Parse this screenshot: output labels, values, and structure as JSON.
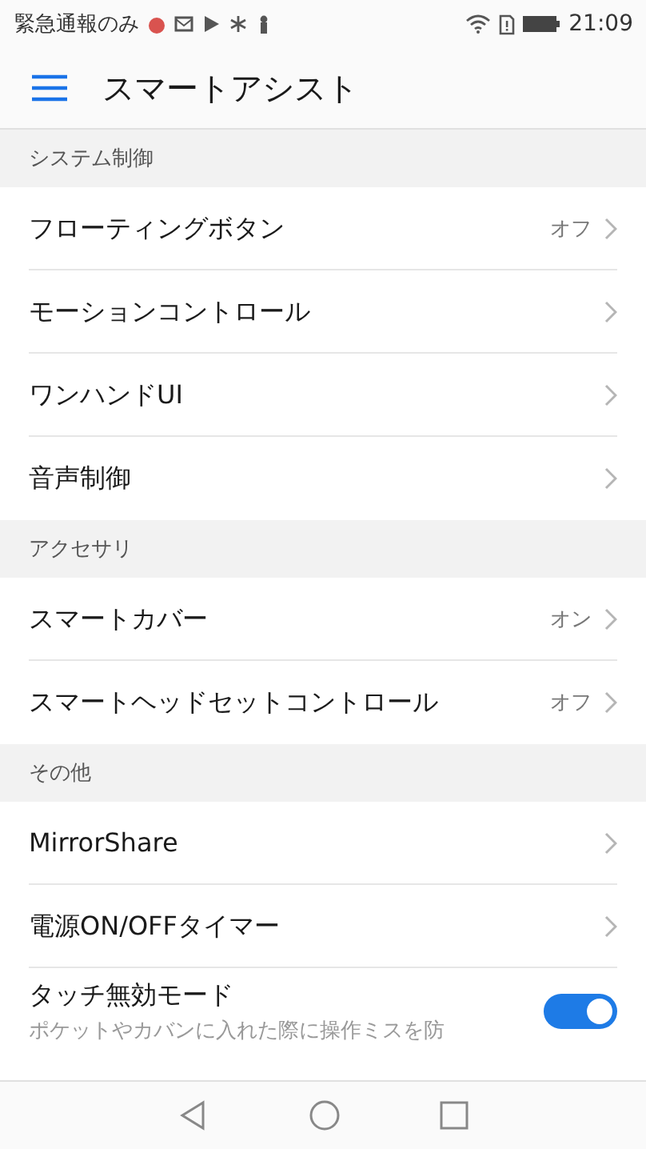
{
  "status_bar": {
    "carrier": "緊急通報のみ",
    "time": "21:09"
  },
  "app_bar": {
    "title": "スマートアシスト"
  },
  "sections": [
    {
      "title": "システム制御",
      "items": [
        {
          "kind": "link",
          "label": "フローティングボタン",
          "value": "オフ"
        },
        {
          "kind": "link",
          "label": "モーションコントロール"
        },
        {
          "kind": "link",
          "label": "ワンハンドUI"
        },
        {
          "kind": "link",
          "label": "音声制御"
        }
      ]
    },
    {
      "title": "アクセサリ",
      "items": [
        {
          "kind": "link",
          "label": "スマートカバー",
          "value": "オン"
        },
        {
          "kind": "link",
          "label": "スマートヘッドセットコントロール",
          "value": "オフ"
        }
      ]
    },
    {
      "title": "その他",
      "items": [
        {
          "kind": "link",
          "label": "MirrorShare"
        },
        {
          "kind": "link",
          "label": "電源ON/OFFタイマー"
        },
        {
          "kind": "toggle",
          "label": "タッチ無効モード",
          "description": "ポケットやカバンに入れた際に操作ミスを防",
          "on": true
        }
      ]
    }
  ]
}
